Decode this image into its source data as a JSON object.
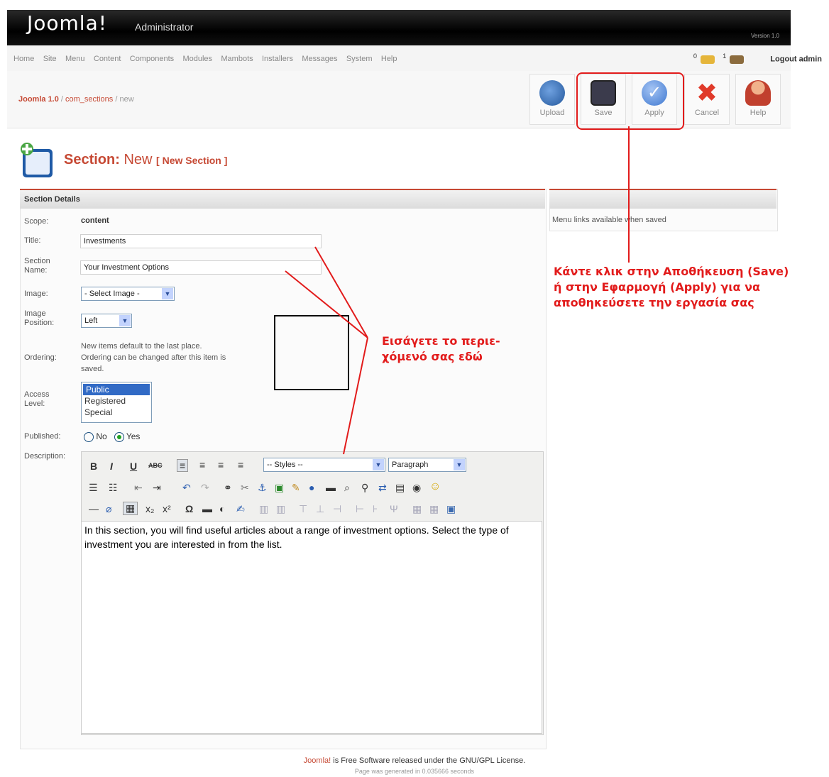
{
  "header": {
    "logo": "Joomla!",
    "logo_sub": "Administrator",
    "version": "Version 1.0"
  },
  "menu": [
    "Home",
    "Site",
    "Menu",
    "Content",
    "Components",
    "Modules",
    "Mambots",
    "Installers",
    "Messages",
    "System",
    "Help"
  ],
  "status": {
    "messages_count": "0",
    "users_count": "1",
    "logout": "Logout admin"
  },
  "breadcrumb": {
    "root": "Joomla 1.0",
    "component": "com_sections",
    "action": "new"
  },
  "toolbar": {
    "upload": "Upload",
    "save": "Save",
    "apply": "Apply",
    "cancel": "Cancel",
    "help": "Help"
  },
  "page": {
    "title": "Section:",
    "mode": "New",
    "subtitle": "[ New Section ]"
  },
  "details": {
    "heading": "Section Details",
    "scope_label": "Scope:",
    "scope_value": "content",
    "title_label": "Title:",
    "title_value": "Investments",
    "name_label_1": "Section",
    "name_label_2": "Name:",
    "name_value": "Your Investment Options",
    "image_label": "Image:",
    "image_value": "- Select Image -",
    "pos_label_1": "Image",
    "pos_label_2": "Position:",
    "pos_value": "Left",
    "ordering_label": "Ordering:",
    "ordering_1": "New items default to the last place.",
    "ordering_2": "Ordering can be changed after this item is",
    "ordering_3": "saved.",
    "access_label_1": "Access",
    "access_label_2": "Level:",
    "access_options": [
      "Public",
      "Registered",
      "Special"
    ],
    "published_label": "Published:",
    "no": "No",
    "yes": "Yes",
    "description_label": "Description:"
  },
  "editor": {
    "styles": "-- Styles --",
    "format": "Paragraph",
    "content": "In this section, you will find useful articles about a range of investment options. Select the type of investment you are interested in from the list."
  },
  "side": {
    "menu_links": "Menu links available when saved"
  },
  "annotations": {
    "enter_content_1": "Εισάγετε το περιε-",
    "enter_content_2": "χόμενό σας εδώ",
    "save_1": "Κάντε κλικ στην Αποθήκευση (Save)",
    "save_2": "ή στην Εφαρμογή (Apply) για να",
    "save_3": "αποθηκεύσετε την εργασία σας"
  },
  "footer": {
    "joomla": "Joomla!",
    "text": " is Free Software released under the GNU/GPL License.",
    "generated": "Page was generated in 0.035666 seconds"
  },
  "colors": {
    "accent": "#c64934",
    "annotation": "#e21b1b"
  }
}
